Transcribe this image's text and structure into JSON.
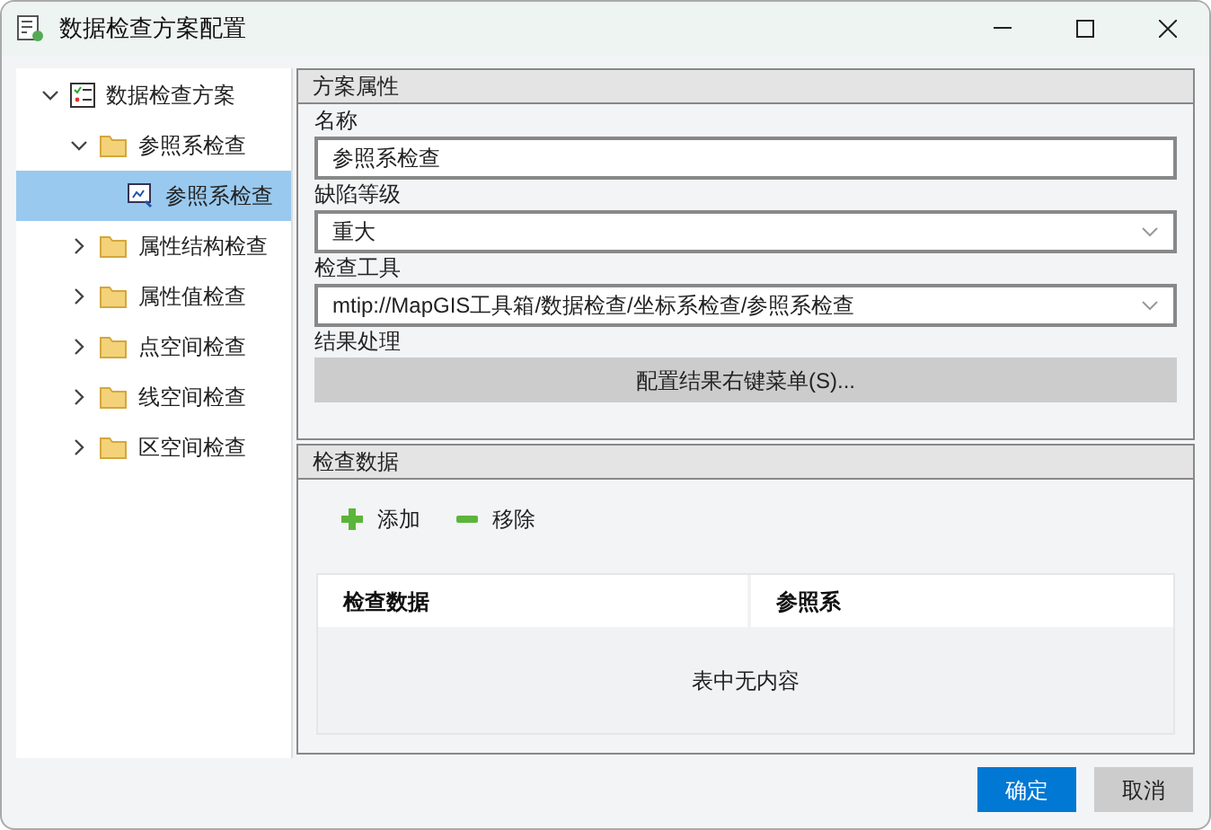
{
  "window": {
    "title": "数据检查方案配置"
  },
  "tree": [
    {
      "label": "数据检查方案",
      "kind": "scheme",
      "expanded": true,
      "selected": false,
      "children": [
        {
          "label": "参照系检查",
          "kind": "folder",
          "expanded": true,
          "selected": false,
          "children": [
            {
              "label": "参照系检查",
              "kind": "check",
              "selected": true
            }
          ]
        },
        {
          "label": "属性结构检查",
          "kind": "folder",
          "expanded": false,
          "selected": false
        },
        {
          "label": "属性值检查",
          "kind": "folder",
          "expanded": false,
          "selected": false
        },
        {
          "label": "点空间检查",
          "kind": "folder",
          "expanded": false,
          "selected": false
        },
        {
          "label": "线空间检查",
          "kind": "folder",
          "expanded": false,
          "selected": false
        },
        {
          "label": "区空间检查",
          "kind": "folder",
          "expanded": false,
          "selected": false
        }
      ]
    }
  ],
  "properties": {
    "title": "方案属性",
    "fields": [
      {
        "label": "名称",
        "kind": "text",
        "value": "参照系检查"
      },
      {
        "label": "缺陷等级",
        "kind": "select",
        "value": "重大"
      },
      {
        "label": "检查工具",
        "kind": "select",
        "value": "mtip://MapGIS工具箱/数据检查/坐标系检查/参照系检查"
      },
      {
        "label": "结果处理",
        "kind": "button",
        "value": "配置结果右键菜单(S)..."
      }
    ]
  },
  "check_data": {
    "title": "检查数据",
    "add": "添加",
    "remove": "移除",
    "columns": [
      "检查数据",
      "参照系"
    ],
    "empty": "表中无内容"
  },
  "buttons": [
    {
      "label": "确定",
      "kind": "primary"
    },
    {
      "label": "取消",
      "kind": "secondary"
    }
  ]
}
